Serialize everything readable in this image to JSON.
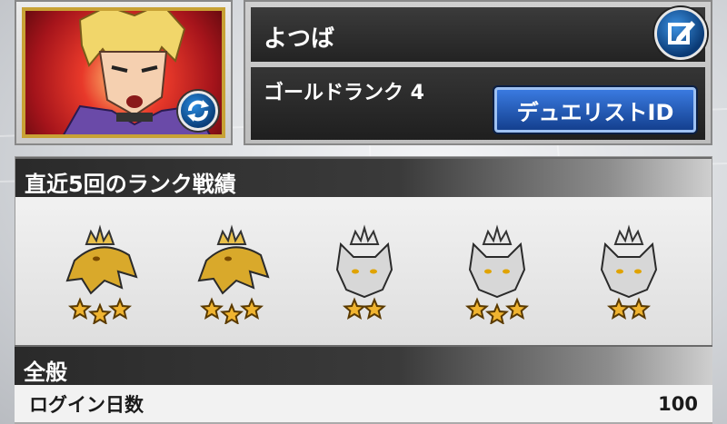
{
  "profile": {
    "name": "よつば",
    "rank": "ゴールドランク 4",
    "duelist_id_label": "デュエリストID"
  },
  "recent": {
    "title": "直近5回のランク戦績",
    "medals": [
      {
        "type": "gold-eagle",
        "stars": 3
      },
      {
        "type": "gold-eagle",
        "stars": 3
      },
      {
        "type": "silver-wolf",
        "stars": 2
      },
      {
        "type": "silver-wolf",
        "stars": 3
      },
      {
        "type": "silver-wolf",
        "stars": 2
      }
    ]
  },
  "general": {
    "title": "全般",
    "login_days_label": "ログイン日数",
    "login_days_value": "100"
  },
  "colors": {
    "gold": "#d9a92b",
    "silver": "#d7d7d7",
    "accent_blue": "#1e5bc6"
  }
}
